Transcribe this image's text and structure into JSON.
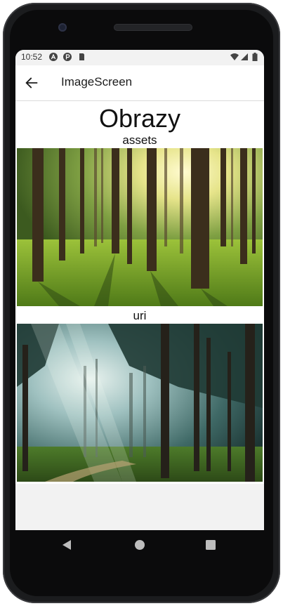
{
  "status_bar": {
    "time": "10:52",
    "left_icons": [
      "a-icon",
      "p-icon",
      "sd-card-icon"
    ],
    "right_icons": [
      "wifi-icon",
      "signal-icon",
      "battery-icon"
    ]
  },
  "app_bar": {
    "back_icon": "arrow-left-icon",
    "title": "ImageScreen"
  },
  "content": {
    "heading": "Obrazy",
    "sections": [
      {
        "label": "assets",
        "image": "forest-sunlight-image"
      },
      {
        "label": "uri",
        "image": "forest-misty-image"
      }
    ]
  },
  "nav_bar": {
    "buttons": [
      "back-triangle-icon",
      "home-circle-icon",
      "recents-square-icon"
    ]
  },
  "colors": {
    "screen_bg": "#f2f2f2",
    "text": "#111111",
    "phone_frame": "#1b1c1e"
  }
}
